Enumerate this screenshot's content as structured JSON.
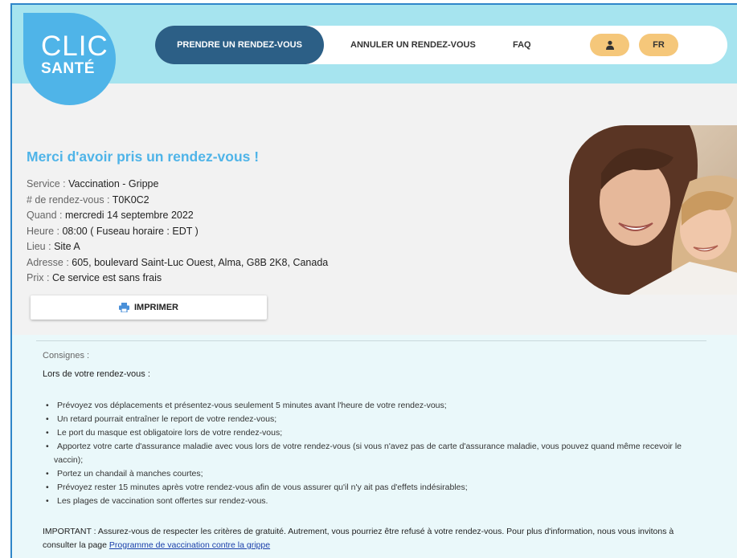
{
  "logo": {
    "line1": "CLIC",
    "line2": "SANTÉ"
  },
  "nav": {
    "book": "PRENDRE UN RENDEZ-VOUS",
    "cancel": "ANNULER UN RENDEZ-VOUS",
    "faq": "FAQ",
    "lang": "FR",
    "account_icon": "user-icon"
  },
  "confirmation": {
    "title": "Merci d'avoir pris un rendez-vous !",
    "fields": [
      {
        "label": "Service : ",
        "value": "Vaccination - Grippe"
      },
      {
        "label": "# de rendez-vous : ",
        "value": "T0K0C2"
      },
      {
        "label": "Quand : ",
        "value": "mercredi 14 septembre 2022"
      },
      {
        "label": "Heure : ",
        "value": "08:00 ( Fuseau horaire : EDT )"
      },
      {
        "label": "Lieu : ",
        "value": "Site A"
      },
      {
        "label": "Adresse : ",
        "value": "605, boulevard Saint-Luc Ouest, Alma, G8B 2K8, Canada"
      },
      {
        "label": "Prix : ",
        "value": "Ce service est sans frais"
      }
    ],
    "print_label": "IMPRIMER",
    "print_icon": "printer-icon"
  },
  "notes": {
    "heading": "Consignes :",
    "intro": "Lors de votre rendez-vous :",
    "items": [
      "Prévoyez vos déplacements et présentez-vous seulement 5 minutes avant l'heure de votre rendez-vous;",
      "Un retard pourrait entraîner le report de votre rendez-vous;",
      "Le port du masque est obligatoire lors de votre rendez-vous;",
      "Apportez votre carte d'assurance maladie avec vous lors de votre rendez-vous (si vous n'avez pas de carte d'assurance maladie, vous pouvez quand même recevoir le vaccin);",
      "Portez un chandail à manches courtes;",
      "Prévoyez rester 15 minutes après votre rendez-vous afin de vous assurer qu'il n'y ait pas d'effets indésirables;",
      "Les plages de vaccination sont offertes sur rendez-vous."
    ],
    "important_text": "IMPORTANT : Assurez-vous de respecter les critères de gratuité. Autrement, vous pourriez être refusé à votre rendez-vous. Pour plus d'information, nous vous invitons à consulter la page ",
    "important_link": "Programme de vaccination contre la grippe"
  },
  "colors": {
    "header": "#a6e4ef",
    "logo": "#4fb4e8",
    "nav_active": "#2c5f86",
    "pill": "#f5c77a",
    "title": "#4fb4e8"
  }
}
